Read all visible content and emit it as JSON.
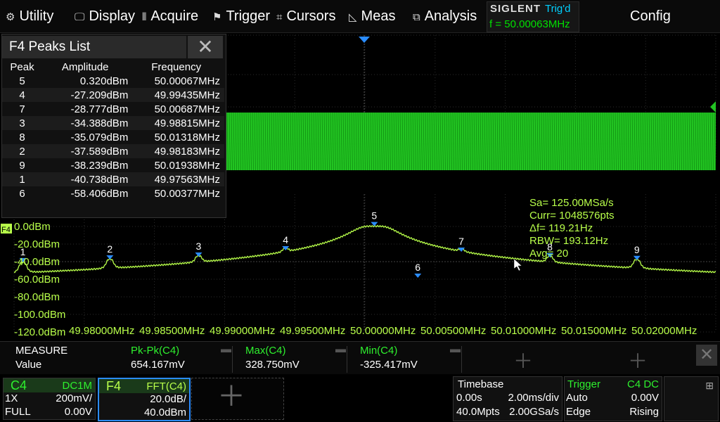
{
  "menu": {
    "items": [
      {
        "label": "Utility",
        "icon": "gear-icon",
        "glyph": "⚙"
      },
      {
        "label": "Display",
        "icon": "display-icon",
        "glyph": "🖵"
      },
      {
        "label": "Acquire",
        "icon": "acquire-icon",
        "glyph": "⫴"
      },
      {
        "label": "Trigger",
        "icon": "trigger-flag-icon",
        "glyph": "⚑"
      },
      {
        "label": "Cursors",
        "icon": "cursors-icon",
        "glyph": "⌗"
      },
      {
        "label": "Meas",
        "icon": "meas-icon",
        "glyph": "◺"
      },
      {
        "label": "Analysis",
        "icon": "analysis-icon",
        "glyph": "⧉"
      }
    ],
    "brand": "SIGLENT",
    "trigger_status": "Trig'd",
    "frequency": "f = 50.00063MHz",
    "config": "Config"
  },
  "peaks_list": {
    "title": "F4 Peaks List",
    "headers": [
      "Peak",
      "Amplitude",
      "Frequency"
    ],
    "rows": [
      {
        "peak": "5",
        "amplitude": "0.320dBm",
        "frequency": "50.00067MHz"
      },
      {
        "peak": "4",
        "amplitude": "-27.209dBm",
        "frequency": "49.99435MHz"
      },
      {
        "peak": "7",
        "amplitude": "-28.777dBm",
        "frequency": "50.00687MHz"
      },
      {
        "peak": "3",
        "amplitude": "-34.388dBm",
        "frequency": "49.98815MHz"
      },
      {
        "peak": "8",
        "amplitude": "-35.079dBm",
        "frequency": "50.01318MHz"
      },
      {
        "peak": "2",
        "amplitude": "-37.589dBm",
        "frequency": "49.98183MHz"
      },
      {
        "peak": "9",
        "amplitude": "-38.239dBm",
        "frequency": "50.01938MHz"
      },
      {
        "peak": "1",
        "amplitude": "-40.738dBm",
        "frequency": "49.97563MHz"
      },
      {
        "peak": "6",
        "amplitude": "-58.406dBm",
        "frequency": "50.00377MHz"
      }
    ]
  },
  "fft": {
    "channel_tag": "F4",
    "y_labels": [
      "0.0dBm",
      "-20.0dBm",
      "-40.0dBm",
      "-60.0dBm",
      "-80.0dBm",
      "-100.0dBm",
      "-120.0dBm"
    ],
    "x_labels": [
      "49.98000MHz",
      "49.98500MHz",
      "49.99000MHz",
      "49.99500MHz",
      "50.00000MHz",
      "50.00500MHz",
      "50.01000MHz",
      "50.01500MHz",
      "50.02000MHz"
    ],
    "info": [
      "Sa=  125.00MSa/s",
      "Curr= 1048576pts",
      "Δf=  119.21Hz",
      "RBW=  193.12Hz",
      "Avg= 20"
    ],
    "markers": [
      {
        "label": "1",
        "freq_mhz": 49.97563,
        "dbm": -40.738
      },
      {
        "label": "2",
        "freq_mhz": 49.98183,
        "dbm": -37.589
      },
      {
        "label": "3",
        "freq_mhz": 49.98815,
        "dbm": -34.388
      },
      {
        "label": "4",
        "freq_mhz": 49.99435,
        "dbm": -27.209
      },
      {
        "label": "5",
        "freq_mhz": 50.00067,
        "dbm": 0.32
      },
      {
        "label": "6",
        "freq_mhz": 50.00377,
        "dbm": -58.406
      },
      {
        "label": "7",
        "freq_mhz": 50.00687,
        "dbm": -28.777
      },
      {
        "label": "8",
        "freq_mhz": 50.01318,
        "dbm": -35.079
      },
      {
        "label": "9",
        "freq_mhz": 50.01938,
        "dbm": -38.239
      }
    ]
  },
  "measure": {
    "row_label_1": "MEASURE",
    "row_label_2": "Value",
    "items": [
      {
        "name": "Pk-Pk(C4)",
        "value": "654.167mV"
      },
      {
        "name": "Max(C4)",
        "value": "328.750mV"
      },
      {
        "name": "Min(C4)",
        "value": "-325.417mV"
      }
    ]
  },
  "bottom": {
    "c4": {
      "name": "C4",
      "coupling": "DC1M",
      "probe": "1X",
      "scale": "200mV/",
      "bw": "FULL",
      "offset": "0.00V"
    },
    "f4": {
      "name": "F4",
      "source": "FFT(C4)",
      "scale": "20.0dB/",
      "ref": "40.0dBm"
    },
    "timebase": {
      "title": "Timebase",
      "delay": "0.00s",
      "scale": "2.00ms/div",
      "depth": "40.0Mpts",
      "rate": "2.00GSa/s"
    },
    "trigger": {
      "title": "Trigger",
      "source": "C4 DC",
      "mode": "Auto",
      "level": "0.00V",
      "type": "Edge",
      "slope": "Rising"
    }
  },
  "colors": {
    "trace": "#b8ff4a",
    "waveform": "#22c422",
    "marker": "#2a8cff",
    "accent": "#2ef02e",
    "cyan": "#00d0ff"
  }
}
